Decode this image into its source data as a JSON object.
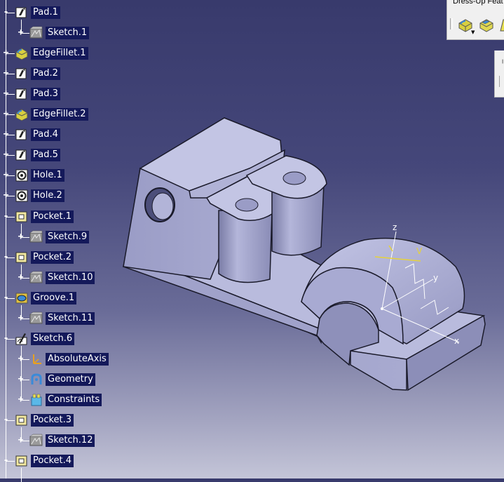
{
  "toolbar": {
    "title": "Dress-Up Feat",
    "buttons": [
      {
        "name": "edge-fillet-icon"
      },
      {
        "name": "chamfer-icon"
      },
      {
        "name": "draft-icon"
      }
    ]
  },
  "tree": {
    "nodes": [
      {
        "label": "Pad.1",
        "icon": "pad-icon",
        "expander": "-",
        "indent": 0
      },
      {
        "label": "Sketch.1",
        "icon": "sketch-icon",
        "expander": "+",
        "indent": 1
      },
      {
        "label": "EdgeFillet.1",
        "icon": "edge-fillet-icon",
        "expander": "+",
        "indent": 0
      },
      {
        "label": "Pad.2",
        "icon": "pad-icon",
        "expander": "+",
        "indent": 0
      },
      {
        "label": "Pad.3",
        "icon": "pad-icon",
        "expander": "+",
        "indent": 0
      },
      {
        "label": "EdgeFillet.2",
        "icon": "edge-fillet-icon",
        "expander": "+",
        "indent": 0
      },
      {
        "label": "Pad.4",
        "icon": "pad-icon",
        "expander": "+",
        "indent": 0
      },
      {
        "label": "Pad.5",
        "icon": "pad-icon",
        "expander": "+",
        "indent": 0
      },
      {
        "label": "Hole.1",
        "icon": "hole-icon",
        "expander": "+",
        "indent": 0
      },
      {
        "label": "Hole.2",
        "icon": "hole-icon",
        "expander": "+",
        "indent": 0
      },
      {
        "label": "Pocket.1",
        "icon": "pocket-icon",
        "expander": "-",
        "indent": 0
      },
      {
        "label": "Sketch.9",
        "icon": "sketch-icon",
        "expander": "+",
        "indent": 1
      },
      {
        "label": "Pocket.2",
        "icon": "pocket-icon",
        "expander": "-",
        "indent": 0
      },
      {
        "label": "Sketch.10",
        "icon": "sketch-icon",
        "expander": "+",
        "indent": 1
      },
      {
        "label": "Groove.1",
        "icon": "groove-icon",
        "expander": "-",
        "indent": 0
      },
      {
        "label": "Sketch.11",
        "icon": "sketch-icon",
        "expander": "+",
        "indent": 1
      },
      {
        "label": "Sketch.6",
        "icon": "sketch-edit-icon",
        "expander": "-",
        "indent": 0
      },
      {
        "label": "AbsoluteAxis",
        "icon": "axis-icon",
        "expander": "+",
        "indent": 1
      },
      {
        "label": "Geometry",
        "icon": "geometry-icon",
        "expander": "+",
        "indent": 1
      },
      {
        "label": "Constraints",
        "icon": "constraints-icon",
        "expander": "+",
        "indent": 1
      },
      {
        "label": "Pocket.3",
        "icon": "pocket-icon",
        "expander": "-",
        "indent": 0
      },
      {
        "label": "Sketch.12",
        "icon": "sketch-icon",
        "expander": "+",
        "indent": 1
      },
      {
        "label": "Pocket.4",
        "icon": "pocket-icon",
        "expander": "-",
        "indent": 0
      }
    ]
  },
  "viewport": {
    "axis_labels": {
      "z": "z",
      "y": "y",
      "x": "x",
      "v": "V"
    },
    "colors": {
      "part_face": "#a4a6cc",
      "part_top": "#bfc1e0",
      "part_dark": "#7c7ea8",
      "edge": "#1a1a2a",
      "sketch_axis": "#ffffff",
      "sketch_yellow": "#e6d23a"
    }
  }
}
